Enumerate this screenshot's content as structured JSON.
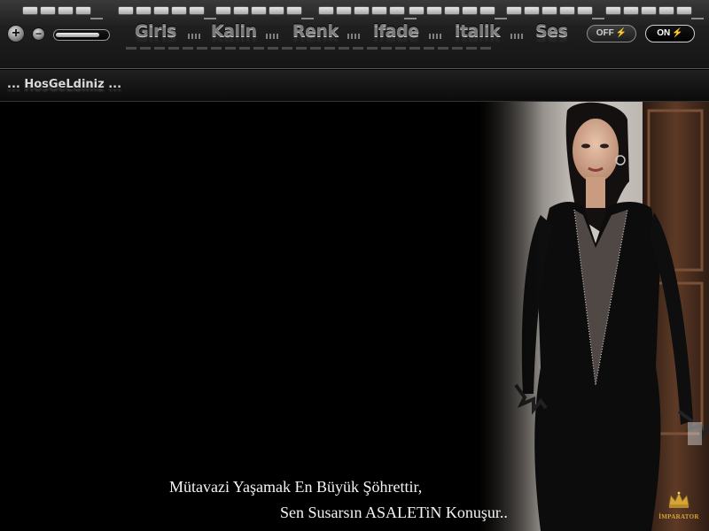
{
  "toolbar": {
    "menu": [
      {
        "label": "Giris"
      },
      {
        "label": "Kalin"
      },
      {
        "label": "Renk"
      },
      {
        "label": "ifade"
      },
      {
        "label": "italik"
      },
      {
        "label": "Ses"
      }
    ],
    "plus_label": "+",
    "minus_label": "−",
    "volume_level": 0.85,
    "toggle_off_label": "OFF",
    "toggle_on_label": "ON",
    "bolt_glyph": "⚡"
  },
  "titlebar": {
    "welcome": "... HosGeLdiniz ..."
  },
  "content": {
    "quote_line_1": "Mütavazi Yaşamak En Büyük Şöhrettir,",
    "quote_line_2": "Sen Susarsın ASALETiN Konuşur..",
    "logo_text": "İMPARATOR",
    "logo_icon": "crown-icon"
  },
  "colors": {
    "background": "#000000",
    "chrome": "#2a2a2a",
    "text_light": "#f4f4f4",
    "logo_gold": "#d4a437"
  }
}
